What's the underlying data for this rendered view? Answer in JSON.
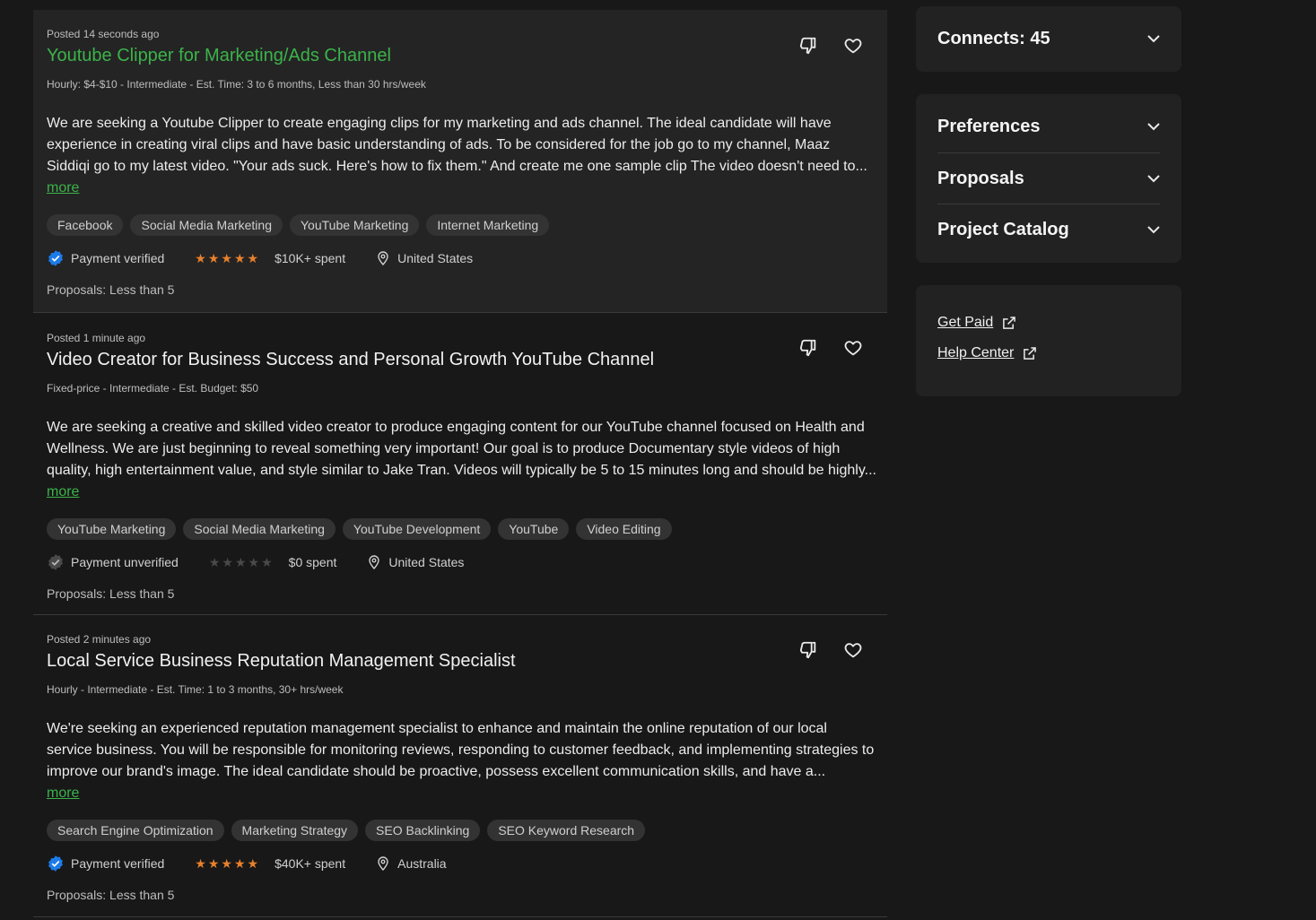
{
  "jobs": [
    {
      "posted": "Posted 14 seconds ago",
      "title": "Youtube Clipper for Marketing/Ads Channel",
      "meta": "Hourly: $4-$10 - Intermediate - Est. Time: 3 to 6 months, Less than 30 hrs/week",
      "description": "We are seeking a Youtube Clipper to create engaging clips for my marketing and ads channel. The ideal candidate will have experience in creating viral clips and have basic understanding of ads. To be considered for the job go to my channel, Maaz Siddiqi go to my latest video. \"Your ads suck. Here's how to fix them.\" And create me one sample clip The video doesn't need to...",
      "more": "more",
      "tags": [
        "Facebook",
        "Social Media Marketing",
        "YouTube Marketing",
        "Internet Marketing"
      ],
      "payment": "Payment verified",
      "verified": true,
      "rating": 5,
      "spent": "$10K+ spent",
      "location": "United States",
      "proposals": "Proposals: Less than 5"
    },
    {
      "posted": "Posted 1 minute ago",
      "title": "Video Creator for Business Success and Personal Growth YouTube Channel",
      "meta": "Fixed-price - Intermediate - Est. Budget: $50",
      "description": "We are seeking a creative and skilled video creator to produce engaging content for our YouTube channel focused on Health and Wellness. We are just beginning to reveal something very important! Our goal is to produce Documentary style videos of high quality, high entertainment value, and style similar to Jake Tran. Videos will typically be 5 to 15 minutes long and should be highly...",
      "more": "more",
      "tags": [
        "YouTube Marketing",
        "Social Media Marketing",
        "YouTube Development",
        "YouTube",
        "Video Editing"
      ],
      "payment": "Payment unverified",
      "verified": false,
      "rating": 0,
      "spent": "$0 spent",
      "location": "United States",
      "proposals": "Proposals: Less than 5"
    },
    {
      "posted": "Posted 2 minutes ago",
      "title": "Local Service Business Reputation Management Specialist",
      "meta": "Hourly - Intermediate - Est. Time: 1 to 3 months, 30+ hrs/week",
      "description": "We're seeking an experienced reputation management specialist to enhance and maintain the online reputation of our local service business. You will be responsible for monitoring reviews, responding to customer feedback, and implementing strategies to improve our brand's image. The ideal candidate should be proactive, possess excellent communication skills, and have a...",
      "more": "more",
      "tags": [
        "Search Engine Optimization",
        "Marketing Strategy",
        "SEO Backlinking",
        "SEO Keyword Research"
      ],
      "payment": "Payment verified",
      "verified": true,
      "rating": 5,
      "spent": "$40K+ spent",
      "location": "Australia",
      "proposals": "Proposals: Less than 5"
    }
  ],
  "sidebar": {
    "connects": "Connects: 45",
    "sections": [
      "Preferences",
      "Proposals",
      "Project Catalog"
    ],
    "links": [
      "Get Paid",
      "Help Center"
    ]
  },
  "colors": {
    "accent_green": "#3bb34a",
    "star_orange": "#e8812c",
    "verified_blue": "#1d7be8"
  }
}
